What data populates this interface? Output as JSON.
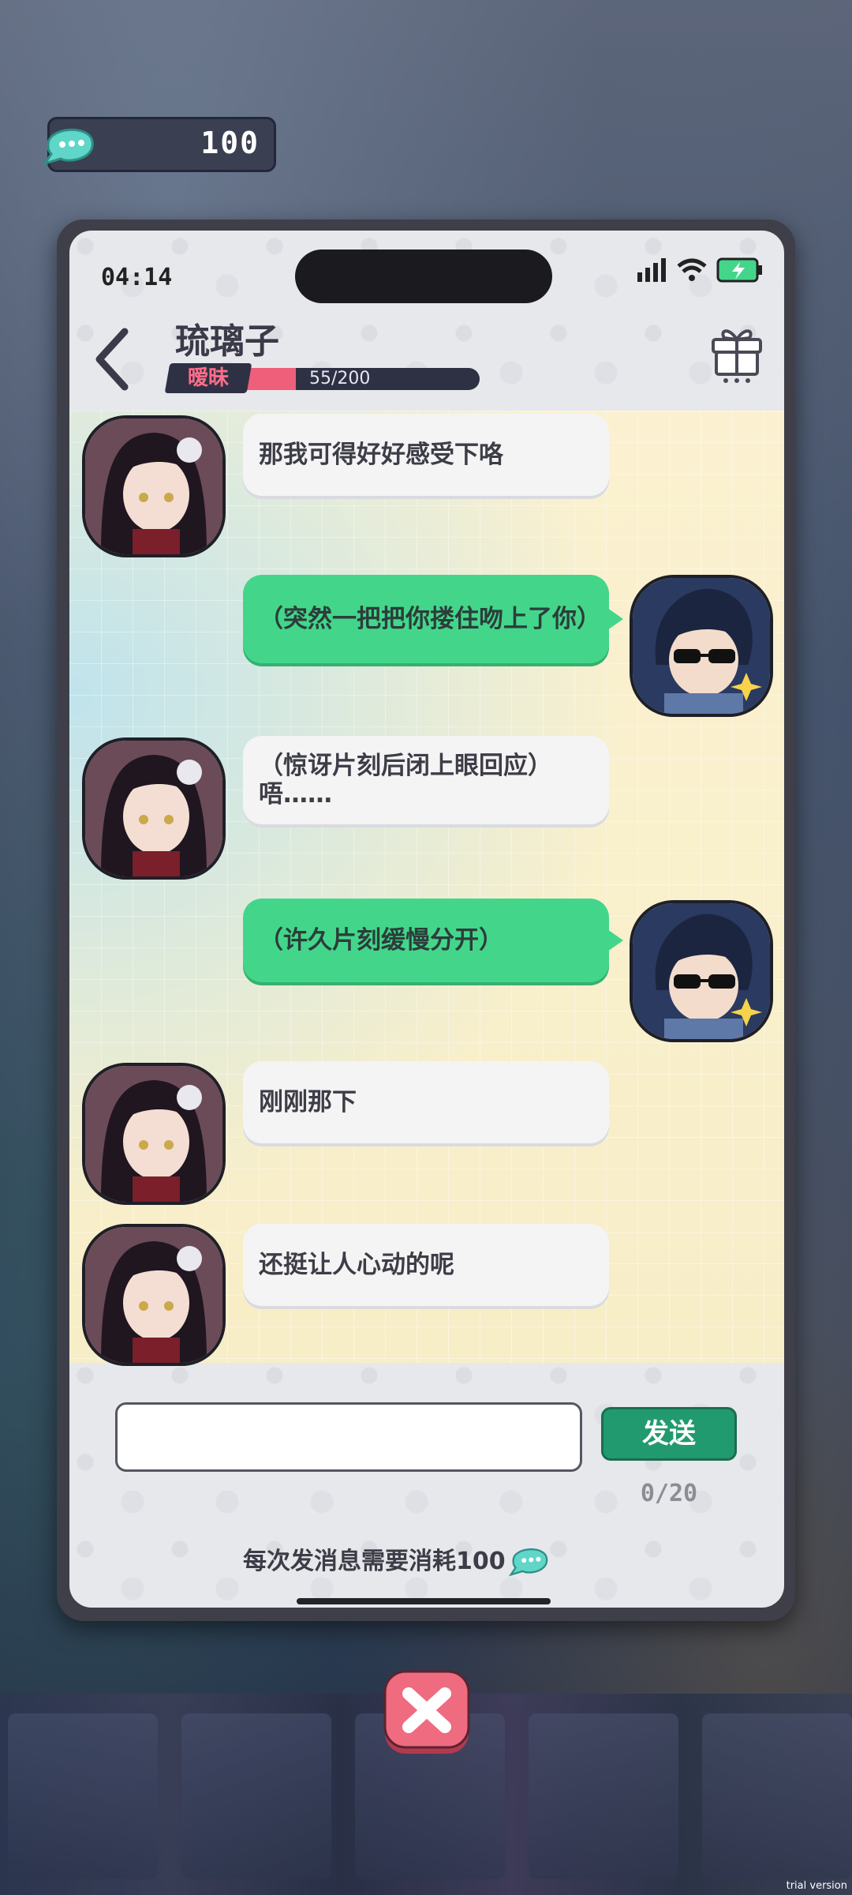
{
  "currency": {
    "icon": "chat-bubble-coin-icon",
    "amount": "100"
  },
  "status_bar": {
    "time": "04:14"
  },
  "header": {
    "contact_name": "琉璃子",
    "relationship_label": "暧昧",
    "relationship_value": "55/200",
    "relationship_progress": 0.275
  },
  "messages": [
    {
      "from": "them",
      "text": "那我可得好好感受下咯"
    },
    {
      "from": "me",
      "text": "（突然一把把你搂住吻上了你）"
    },
    {
      "from": "them",
      "text": "（惊讶片刻后闭上眼回应）唔……"
    },
    {
      "from": "me",
      "text": "（许久片刻缓慢分开）"
    },
    {
      "from": "them",
      "text": "刚刚那下"
    },
    {
      "from": "them",
      "text": "还挺让人心动的呢"
    }
  ],
  "composer": {
    "placeholder": "",
    "send_label": "发送",
    "counter": "0/20",
    "cost_note": "每次发消息需要消耗100"
  },
  "watermark": "trial version",
  "colors": {
    "send": "#229a6f",
    "my_bubble": "#43d68b",
    "relationship": "#ef5f7a"
  }
}
